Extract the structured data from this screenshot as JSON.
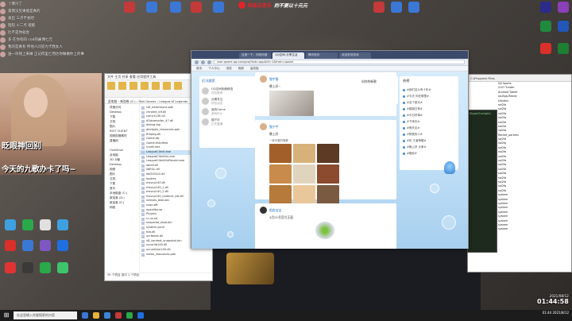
{
  "stream_overlay": {
    "chat": [
      {
        "badge": "",
        "text": "丫寒冷了"
      },
      {
        "badge": "",
        "text": "第我没见果能是真的"
      },
      {
        "badge": "",
        "text": "发出 三点不会吧"
      },
      {
        "badge": "",
        "text": "陪陪 十二点 能能"
      },
      {
        "badge": "",
        "text": "比不是你就会"
      },
      {
        "badge": "",
        "text": "多 在你有四 cod的雇佣七元"
      },
      {
        "badge": "",
        "text": "我的是真有 所他人问答为卡我女人"
      },
      {
        "badge": "",
        "text": "送一块钱上来做 正记得里亡而达你做做你上的事"
      }
    ],
    "caption_line1": "眨眼神回别",
    "caption_line2": "今天的九歌办卡了吗~",
    "banner_brand": "网易云音乐",
    "banner_slogan": "的不要以十元元",
    "clock_date": "2021/08/12",
    "clock_time": "01:44:58"
  },
  "explorer": {
    "title": "文件 主页 共享 查看 应用程序工具",
    "tabs": [
      "文件",
      "主页",
      "共享",
      "查看",
      "应用程序工具"
    ],
    "path": "此电脑 › 新加卷 (E:) › Riot Games › League of Legends",
    "nav": [
      "快速访问",
      "Desktop",
      "下载",
      "文档",
      "图片",
      "RIOT CLIENT",
      "视频剪辑素材",
      "直播用",
      "",
      "OneDrive",
      "此电脑",
      "3D 对象",
      "Desktop",
      "视频",
      "图片",
      "文档",
      "下载",
      "音乐",
      "本地磁盘 (C:)",
      "新加卷 (D:)",
      "新加卷 (E:)",
      "网络"
    ],
    "files": [
      "cef_extensions.pak",
      "chrome_elf.dll",
      "concrt140.dll",
      "d3dcompiler_47.dll",
      "debug.log",
      "devtools_resources.pak",
      "ffmpeg.dll",
      "Game.db",
      "Game.manifest",
      "icudtl.dat",
      "LeagueClient.exe",
      "LeagueClientUx.exe",
      "LeagueClientUxRender.exe",
      "libcef.dll",
      "libEGL.dll",
      "libGLESv2.dll",
      "locales",
      "msvcp140.dll",
      "msvcp140_1.dll",
      "msvcp140_2.dll",
      "msvcp140_codecvt_ids.dll",
      "natives_blob.bin",
      "snap.pft",
      "openlibs.so",
      "Plugins",
      "rc-us.sd",
      "snapshot_blob.bin",
      "system.yaml",
      "tbb.dll",
      "ucrtbase.dll",
      "v8_context_snapshot.bin",
      "vccorlib140.dll",
      "vcruntime140.dll",
      "views_resources.pak"
    ],
    "selected_index": 10,
    "status": "59 个项目  选中 1 个项目"
  },
  "browser": {
    "tabs": [
      "百度一下，你就知道",
      "QQ空间-分享生活",
      "腾讯首页",
      "欢迎来到游戏"
    ],
    "active_tab": 1,
    "url": "user.qzone.qq.com/proj?tab=app&hf=1&from=qzone",
    "bookmarks": [
      "首页",
      "个人中心",
      "说说",
      "相册",
      "留言板"
    ],
    "left_panel": {
      "title": "近况搜索",
      "items": [
        {
          "name": "QQ空间相册精选",
          "sub": "好友推荐"
        },
        {
          "name": "近期关注",
          "sub": "好友动态"
        },
        {
          "name": "我的Game",
          "sub": "游戏中心"
        },
        {
          "name": "猫宁宇",
          "sub": "正在直播"
        }
      ]
    },
    "music_panel": {
      "text": "向你的新歌"
    },
    "posts": [
      {
        "name": "猫宇猫",
        "time": "2021-08-10",
        "text": "晚上好~",
        "foot": [
          "赞 8",
          "评论 3",
          "转发"
        ]
      },
      {
        "name": "猫宁宇",
        "time": "2021-08-11 21:45",
        "text": "晚上好",
        "subtext": "一家可爱的晚餐",
        "foot": [
          "2021-03-18 21:46",
          "评论",
          "转发"
        ]
      },
      {
        "name": "相恋宝宝",
        "time": "2021-08-11",
        "text": "4月21号官方正面",
        "foot": []
      }
    ],
    "right_panel": {
      "title": "热榜",
      "items": [
        "#我们这么有十年#",
        "#今天 你在哪里#",
        "#这个夏天#",
        "#猫猫日常#",
        "#今日好事#",
        "#下雨天#",
        "#明天见#",
        "#熬夜的人#",
        "#玩 王者荣耀#",
        "#晚上好 大家#",
        "#晚安#"
      ]
    }
  },
  "right_window": {
    "title": "C:\\Program Files",
    "lines": [
      "DJI Sports",
      "CLIO Tunder",
      "Android Tablet",
      "aa-Bpp-Ready",
      "kimakin",
      "sal2fa",
      "sal2fa",
      "sal2fa",
      "sal2fa",
      "sal2fa",
      "sal2fa",
      "sal2fa",
      "Rocket_params",
      "sal2fa",
      "sal2fa",
      "sal2fa",
      "sal2fa",
      "sal2fa",
      "sal2fa",
      "sal2fa",
      "sal2fa",
      "sal2fa",
      "sal2fa",
      "sal2fa",
      "sal2fa",
      "sal2fa",
      "system",
      "system",
      "system",
      "system",
      "system",
      "system",
      "system",
      "system",
      "system"
    ],
    "dark_title": "Skype(Sunlight)"
  },
  "desktop_icons_left": [
    {
      "label": "",
      "color": "#3fa0e0"
    },
    {
      "label": "",
      "color": "#2aa84a"
    },
    {
      "label": "",
      "color": "#e0e0e0"
    },
    {
      "label": "",
      "color": "#3fa0e0"
    },
    {
      "label": "",
      "color": "#d9302a"
    },
    {
      "label": "",
      "color": "#3b78d6"
    },
    {
      "label": "",
      "color": "#7e57c2"
    },
    {
      "label": "",
      "color": "#1f6fe0"
    },
    {
      "label": "",
      "color": "#e03434"
    },
    {
      "label": "",
      "color": "#3a3a3a"
    },
    {
      "label": "",
      "color": "#2aa84a"
    },
    {
      "label": "",
      "color": "#3ec46d"
    }
  ],
  "desktop_icons_top": [
    {
      "label": "",
      "color": "#c4393a"
    },
    {
      "label": "",
      "color": "#3b78d6"
    },
    {
      "label": "",
      "color": "#3b78d6"
    },
    {
      "label": "",
      "color": "#c4393a"
    },
    {
      "label": "",
      "color": "#3b78d6"
    },
    {
      "label": "",
      "color": "#c4393a"
    },
    {
      "label": "",
      "color": "#3b78d6"
    },
    {
      "label": "",
      "color": "#3b78d6"
    }
  ],
  "desktop_icons_right": [
    {
      "label": "",
      "color": "#2b2b8a"
    },
    {
      "label": "",
      "color": "#8b3fb8"
    },
    {
      "label": "",
      "color": "#1f8a3e"
    },
    {
      "label": "",
      "color": "#2256b8"
    },
    {
      "label": "",
      "color": "#d9302a"
    },
    {
      "label": "",
      "color": "#1e7e34"
    }
  ],
  "taskbar": {
    "search_placeholder": "在这里输入你要搜索的内容",
    "tray_text": "01:44\n2021/8/12"
  }
}
